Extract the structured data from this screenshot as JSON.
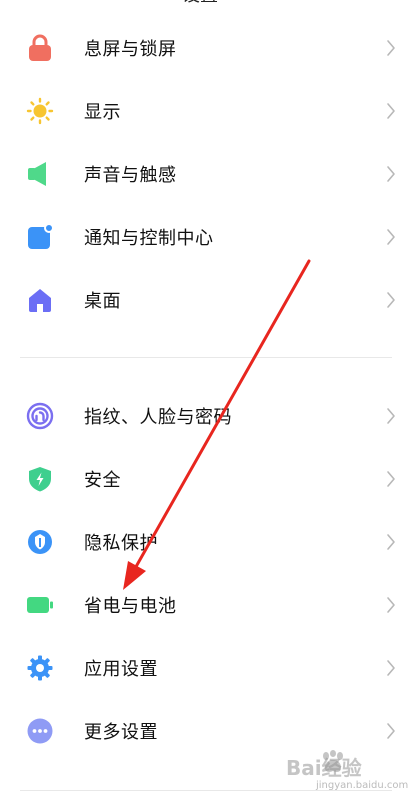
{
  "settings": {
    "group1": [
      {
        "id": "lock-screen",
        "label": "息屏与锁屏",
        "icon": "lock-icon",
        "color": "#f06f60"
      },
      {
        "id": "display",
        "label": "显示",
        "icon": "sun-icon",
        "color": "#f7c531"
      },
      {
        "id": "sound",
        "label": "声音与触感",
        "icon": "speaker-icon",
        "color": "#4fd98a"
      },
      {
        "id": "notifications",
        "label": "通知与控制中心",
        "icon": "notification-icon",
        "color": "#3b93f7"
      },
      {
        "id": "home-screen",
        "label": "桌面",
        "icon": "home-icon",
        "color": "#6b6ef5"
      }
    ],
    "group2": [
      {
        "id": "fingerprint",
        "label": "指纹、人脸与密码",
        "icon": "fingerprint-icon",
        "color": "#7b6ff0"
      },
      {
        "id": "security",
        "label": "安全",
        "icon": "shield-icon",
        "color": "#3ecf8e"
      },
      {
        "id": "privacy",
        "label": "隐私保护",
        "icon": "privacy-icon",
        "color": "#3b93f7"
      },
      {
        "id": "battery",
        "label": "省电与电池",
        "icon": "battery-icon",
        "color": "#43d881"
      },
      {
        "id": "apps",
        "label": "应用设置",
        "icon": "gear-icon",
        "color": "#3b93f7"
      },
      {
        "id": "more",
        "label": "更多设置",
        "icon": "more-icon",
        "color": "#8f9bf5"
      }
    ]
  },
  "annotation_color": "#e8261f",
  "watermark": {
    "brand": "Bai经验",
    "url": "jingyan.baidu.com"
  }
}
